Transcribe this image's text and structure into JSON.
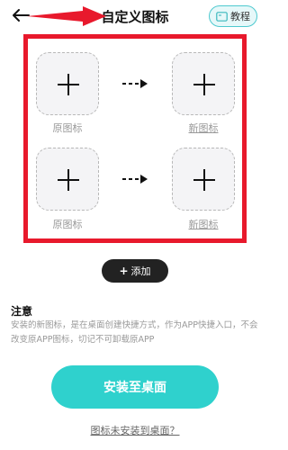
{
  "header": {
    "title": "自定义图标",
    "tutorial_label": "教程"
  },
  "icons": {
    "original_label": "原图标",
    "new_label": "新图标",
    "rows": [
      {
        "original": "原图标",
        "new": "新图标"
      },
      {
        "original": "原图标",
        "new": "新图标"
      }
    ]
  },
  "add_button": {
    "label": "添加"
  },
  "notice": {
    "title": "注意",
    "text": "安装的新图标，是在桌面创建快捷方式，作为APP快捷入口，不会改变原APP图标，切记不可卸载原APP"
  },
  "install_button": {
    "label": "安装至桌面"
  },
  "help_link": {
    "label": "图标未安装到桌面？"
  },
  "colors": {
    "accent": "#2fd1cd",
    "annotation": "#e8192c",
    "add_button_bg": "#222222"
  }
}
